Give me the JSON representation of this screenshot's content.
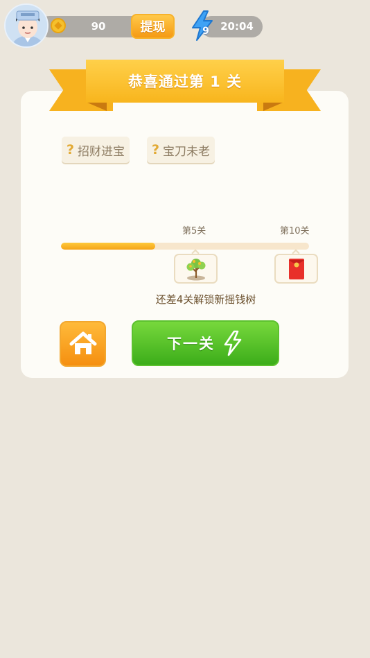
{
  "header": {
    "coins": "90",
    "withdraw_label": "提现",
    "energy_count": "9",
    "timer": "20:04"
  },
  "result": {
    "title": "恭喜通过第 1 关"
  },
  "idioms": [
    {
      "text": "招财进宝"
    },
    {
      "text": "宝刀未老"
    }
  ],
  "progress": {
    "fill_fraction": 0.38,
    "milestones": [
      {
        "label": "第5关",
        "reward": "money-tree-icon"
      },
      {
        "label": "第10关",
        "reward": "red-envelope-icon"
      }
    ],
    "hint": "还差4关解锁新摇钱树"
  },
  "actions": {
    "next_label": "下一关"
  },
  "colors": {
    "background": "#ebe6dc",
    "ribbon": "#f8b51d",
    "home_button": "#f58f10",
    "next_button": "#3cad1a"
  }
}
